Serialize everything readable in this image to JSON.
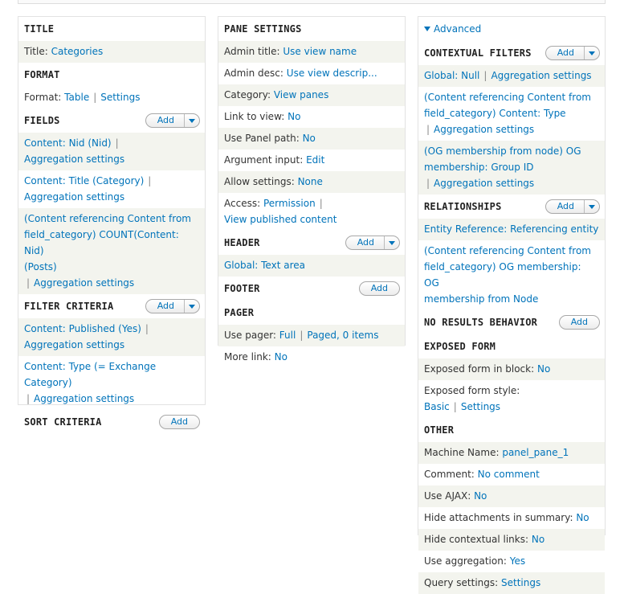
{
  "col1": {
    "title": {
      "heading": "TITLE",
      "label": "Title:",
      "value": "Categories"
    },
    "format": {
      "heading": "FORMAT",
      "label": "Format:",
      "value": "Table",
      "settings": "Settings"
    },
    "fields": {
      "heading": "FIELDS",
      "add": "Add",
      "items": [
        {
          "line1": "Content: Nid (Nid)",
          "agg": "Aggregation settings"
        },
        {
          "line1": "Content: Title (Category)",
          "agg": "Aggregation settings"
        },
        {
          "line1a": "(Content referencing Content from",
          "line1b": "field_category) COUNT(Content: Nid)",
          "line1c": "(Posts)",
          "agg": "Aggregation settings"
        }
      ]
    },
    "filter": {
      "heading": "FILTER CRITERIA",
      "add": "Add",
      "items": [
        {
          "line1": "Content: Published (Yes)",
          "agg": "Aggregation settings"
        },
        {
          "line1a": "Content: Type (= Exchange",
          "line1b": "Category)",
          "agg": "Aggregation settings"
        }
      ]
    },
    "sort": {
      "heading": "SORT CRITERIA",
      "add": "Add"
    }
  },
  "col2": {
    "pane": {
      "heading": "PANE SETTINGS",
      "rows": [
        {
          "label": "Admin title:",
          "value": "Use view name"
        },
        {
          "label": "Admin desc:",
          "value": "Use view descrip..."
        },
        {
          "label": "Category:",
          "value": "View panes"
        },
        {
          "label": "Link to view:",
          "value": "No"
        },
        {
          "label": "Use Panel path:",
          "value": "No"
        },
        {
          "label": "Argument input:",
          "value": "Edit"
        },
        {
          "label": "Allow settings:",
          "value": "None"
        }
      ],
      "access": {
        "label": "Access:",
        "value": "Permission",
        "value2": "View published content"
      }
    },
    "header": {
      "heading": "HEADER",
      "add": "Add",
      "item": "Global: Text area"
    },
    "footer": {
      "heading": "FOOTER",
      "add": "Add"
    },
    "pager": {
      "heading": "PAGER",
      "use_label": "Use pager:",
      "use_value": "Full",
      "use_value2": "Paged, 0 items",
      "more_label": "More link:",
      "more_value": "No"
    }
  },
  "col3": {
    "advanced": "Advanced",
    "contextual": {
      "heading": "CONTEXTUAL FILTERS",
      "add": "Add",
      "items": [
        {
          "line1": "Global: Null",
          "agg": "Aggregation settings"
        },
        {
          "line1a": "(Content referencing Content from",
          "line1b": "field_category) Content: Type",
          "agg": "Aggregation settings"
        },
        {
          "line1a": "(OG membership from node) OG",
          "line1b": "membership: Group ID",
          "agg": "Aggregation settings"
        }
      ]
    },
    "relationships": {
      "heading": "RELATIONSHIPS",
      "add": "Add",
      "items": [
        {
          "line1": "Entity Reference: Referencing entity"
        },
        {
          "line1a": "(Content referencing Content from",
          "line1b": "field_category) OG membership: OG",
          "line1c": "membership from Node"
        }
      ]
    },
    "noresults": {
      "heading": "NO RESULTS BEHAVIOR",
      "add": "Add"
    },
    "exposed": {
      "heading": "EXPOSED FORM",
      "block_label": "Exposed form in block:",
      "block_value": "No",
      "style_label": "Exposed form style:",
      "style_value": "Basic",
      "style_settings": "Settings"
    },
    "other": {
      "heading": "OTHER",
      "rows": [
        {
          "label": "Machine Name:",
          "value": "panel_pane_1"
        },
        {
          "label": "Comment:",
          "value": "No comment"
        },
        {
          "label": "Use AJAX:",
          "value": "No"
        },
        {
          "label": "Hide attachments in summary:",
          "value": "No"
        },
        {
          "label": "Hide contextual links:",
          "value": "No"
        },
        {
          "label": "Use aggregation:",
          "value": "Yes"
        },
        {
          "label": "Query settings:",
          "value": "Settings"
        }
      ]
    }
  }
}
